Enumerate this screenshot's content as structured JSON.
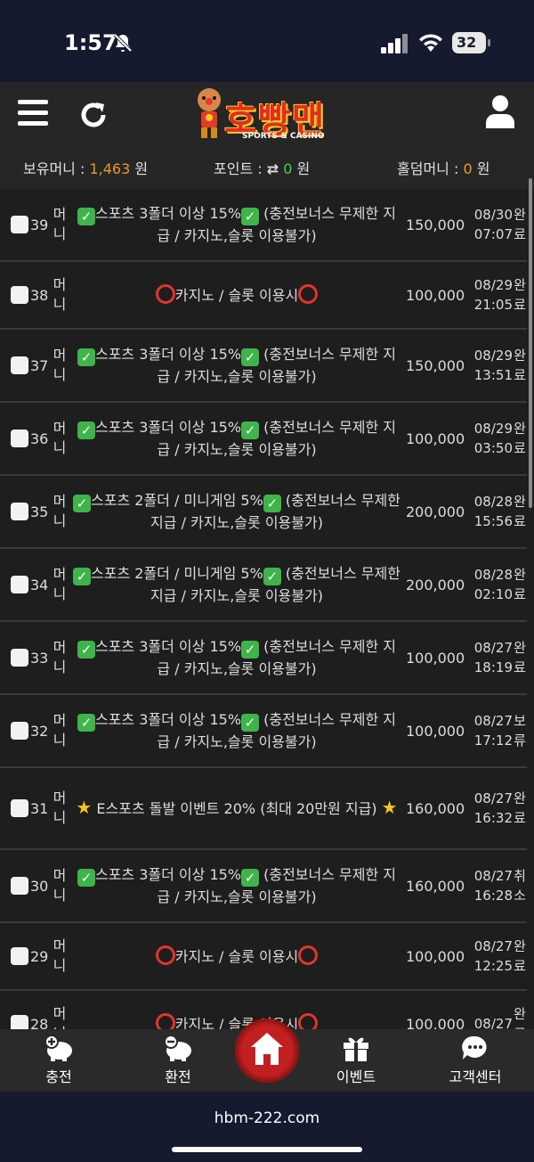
{
  "status_bar": {
    "time": "1:57",
    "battery": "32"
  },
  "header": {
    "logo_text": "호빵맨",
    "logo_subtitle": "SPORTS & CASINO",
    "balance": {
      "money_label": "보유머니 :",
      "money_value": "1,463",
      "money_unit": "원",
      "point_label": "포인트 :",
      "point_value": "0",
      "point_unit": "원",
      "holdem_label": "홀덤머니 :",
      "holdem_value": "0",
      "holdem_unit": "원"
    }
  },
  "list": {
    "rows": [
      {
        "num": "39",
        "cat": "머니",
        "title": "✅스포츠 3폴더 이상 15%✅ (충전보너스 무제한 지급 / 카지노,슬롯 이용불가)",
        "amount": "150,000",
        "date": "08/30",
        "time": "07:07",
        "status": "완료"
      },
      {
        "num": "38",
        "cat": "머니",
        "title": "⭕카지노 / 슬롯 이용시⭕",
        "amount": "100,000",
        "date": "08/29",
        "time": "21:05",
        "status": "완료"
      },
      {
        "num": "37",
        "cat": "머니",
        "title": "✅스포츠 3폴더 이상 15%✅ (충전보너스 무제한 지급 / 카지노,슬롯 이용불가)",
        "amount": "150,000",
        "date": "08/29",
        "time": "13:51",
        "status": "완료"
      },
      {
        "num": "36",
        "cat": "머니",
        "title": "✅스포츠 3폴더 이상 15%✅ (충전보너스 무제한 지급 / 카지노,슬롯 이용불가)",
        "amount": "100,000",
        "date": "08/29",
        "time": "03:50",
        "status": "완료"
      },
      {
        "num": "35",
        "cat": "머니",
        "title": "✅스포츠 2폴더 / 미니게임 5%✅ (충전보너스 무제한 지급 / 카지노,슬롯 이용불가)",
        "amount": "200,000",
        "date": "08/28",
        "time": "15:56",
        "status": "완료"
      },
      {
        "num": "34",
        "cat": "머니",
        "title": "✅스포츠 2폴더 / 미니게임 5%✅ (충전보너스 무제한 지급 / 카지노,슬롯 이용불가)",
        "amount": "200,000",
        "date": "08/28",
        "time": "02:10",
        "status": "완료"
      },
      {
        "num": "33",
        "cat": "머니",
        "title": "✅스포츠 3폴더 이상 15%✅ (충전보너스 무제한 지급 / 카지노,슬롯 이용불가)",
        "amount": "100,000",
        "date": "08/27",
        "time": "18:19",
        "status": "완료"
      },
      {
        "num": "32",
        "cat": "머니",
        "title": "✅스포츠 3폴더 이상 15%✅ (충전보너스 무제한 지급 / 카지노,슬롯 이용불가)",
        "amount": "100,000",
        "date": "08/27",
        "time": "17:12",
        "status": "보류"
      },
      {
        "num": "31",
        "cat": "머니",
        "title": "⭐ E스포츠 돌발 이벤트 20% (최대 20만원 지급) ⭐",
        "amount": "160,000",
        "date": "08/27",
        "time": "16:32",
        "status": "완료"
      },
      {
        "num": "30",
        "cat": "머니",
        "title": "✅스포츠 3폴더 이상 15%✅ (충전보너스 무제한 지급 / 카지노,슬롯 이용불가)",
        "amount": "160,000",
        "date": "08/27",
        "time": "16:28",
        "status": "취소"
      },
      {
        "num": "29",
        "cat": "머니",
        "title": "⭕카지노 / 슬롯 이용시⭕",
        "amount": "100,000",
        "date": "08/27",
        "time": "12:25",
        "status": "완료"
      },
      {
        "num": "28",
        "cat": "머니",
        "title": "⭕카지노 / 슬롯 이용시⭕",
        "amount": "100,000",
        "date": "08/27",
        "time": "",
        "status": "완료"
      }
    ]
  },
  "bottom_nav": {
    "charge": "충전",
    "exchange": "환전",
    "event": "이벤트",
    "support": "고객센터"
  },
  "browser": {
    "url": "hbm-222.com"
  },
  "colors": {
    "accent_orange": "#e89a27",
    "accent_green": "#3fd64a",
    "brand_red": "#e52a2a"
  }
}
